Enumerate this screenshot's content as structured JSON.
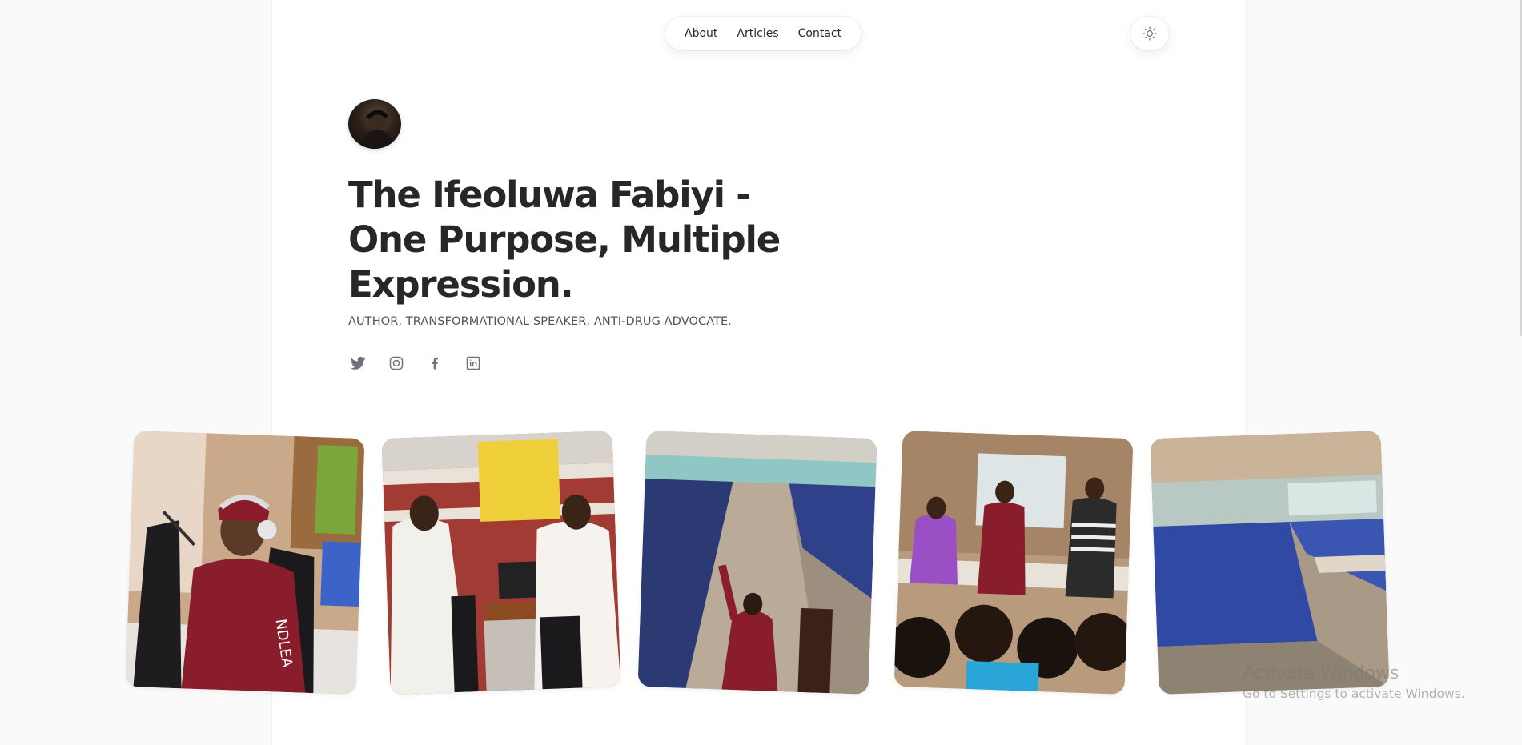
{
  "nav": {
    "items": [
      "About",
      "Articles",
      "Contact"
    ]
  },
  "theme_toggle": {
    "icon": "sun-icon"
  },
  "hero": {
    "title": "The Ifeoluwa Fabiyi - One Purpose, Multiple Expression.",
    "tagline": "AUTHOR, TRANSFORMATIONAL SPEAKER, ANTI-DRUG ADVOCATE."
  },
  "socials": [
    {
      "icon": "twitter-icon"
    },
    {
      "icon": "instagram-icon"
    },
    {
      "icon": "facebook-icon"
    },
    {
      "icon": "linkedin-icon"
    }
  ],
  "photos": [
    {
      "subject": "ndlea-radio-interview-photo"
    },
    {
      "subject": "radio-station-studio-photo"
    },
    {
      "subject": "school-assembly-speech-photo"
    },
    {
      "subject": "classroom-presentation-photo"
    },
    {
      "subject": "students-hall-photo"
    }
  ],
  "colors": {
    "text": "#27272a",
    "muted": "#52525b",
    "panel": "#ffffff",
    "background": "#fafafa",
    "ndlea_maroon": "#8a1d2c"
  },
  "watermark": {
    "title": "Activate Windows",
    "subtitle": "Go to Settings to activate Windows."
  }
}
